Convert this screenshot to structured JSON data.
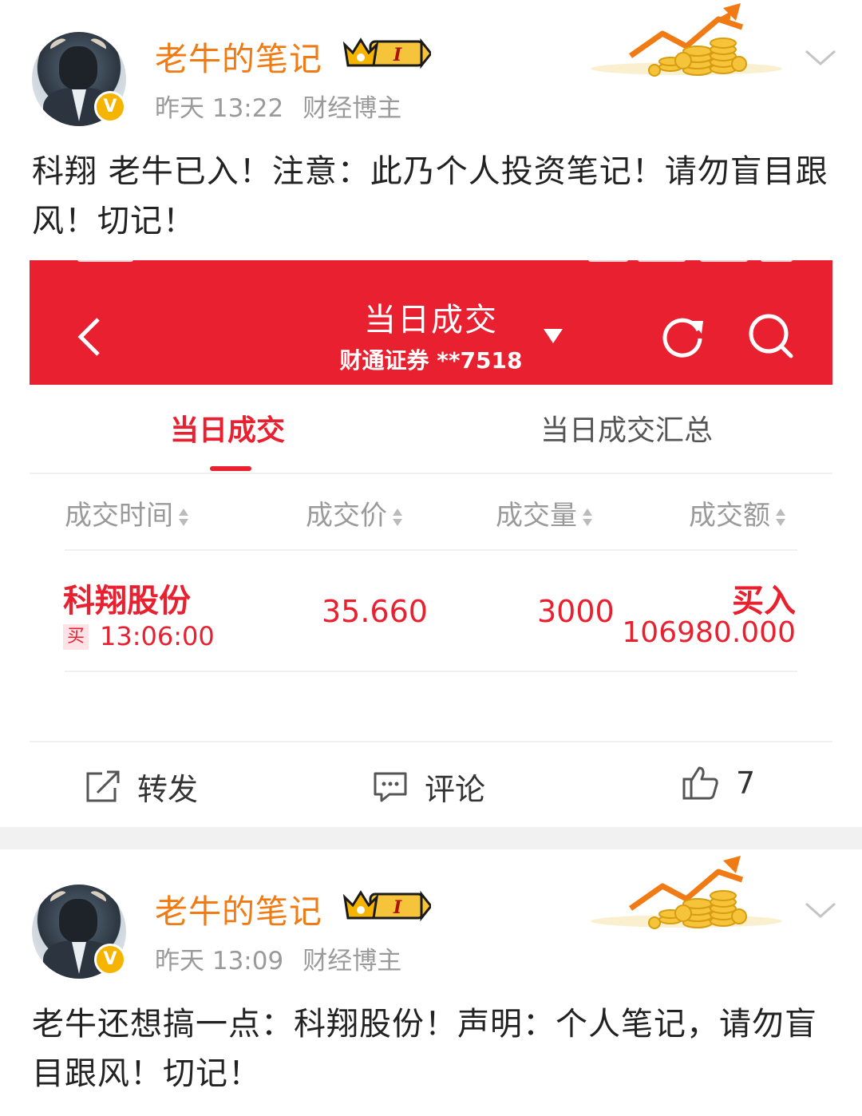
{
  "posts": [
    {
      "username": "老牛的笔记",
      "level_badge": "I",
      "time": "昨天 13:22",
      "category": "财经博主",
      "text": "科翔 老牛已入！注意：此乃个人投资笔记！请勿盲目跟风！切记！",
      "screenshot": {
        "title": "当日成交",
        "subtitle": "财通证券 **7518",
        "tabs": [
          "当日成交",
          "当日成交汇总"
        ],
        "columns": [
          "成交时间",
          "成交价",
          "成交量",
          "成交额"
        ],
        "trade": {
          "name": "科翔股份",
          "tag": "买",
          "time": "13:06:00",
          "price": "35.660",
          "quantity": "3000",
          "direction": "买入",
          "amount": "106980.000"
        }
      },
      "actions": {
        "forward": "转发",
        "comment": "评论",
        "likes": "7"
      }
    },
    {
      "username": "老牛的笔记",
      "level_badge": "I",
      "time": "昨天 13:09",
      "category": "财经博主",
      "text": "老牛还想搞一点：科翔股份！声明：个人笔记，请勿盲目跟风！切记！"
    }
  ],
  "colors": {
    "accent_red": "#e8202f",
    "username_orange": "#f07b14",
    "badge_gold": "#f5b400"
  },
  "icons": [
    "avatar",
    "verified-badge",
    "crown-badge",
    "coins-arrow-decoration",
    "chevron-down-icon",
    "back-icon",
    "dropdown-icon",
    "refresh-icon",
    "search-icon",
    "sort-icon",
    "forward-icon",
    "comment-icon",
    "like-icon"
  ]
}
